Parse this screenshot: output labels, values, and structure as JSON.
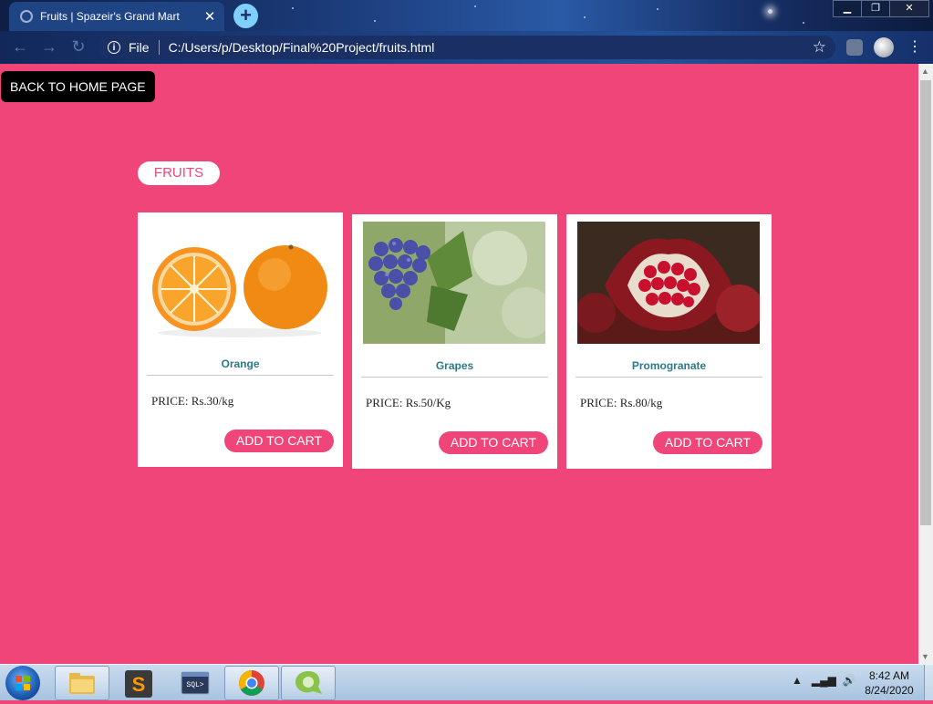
{
  "browser": {
    "tab_title": "Fruits | Spazeir's Grand Mart",
    "close_glyph": "✕",
    "new_tab_glyph": "+",
    "address": {
      "scheme": "File",
      "url": "C:/Users/p/Desktop/Final%20Project/fruits.html"
    }
  },
  "page": {
    "back_button": "BACK TO HOME PAGE",
    "section_title": "FRUITS",
    "products": [
      {
        "name": "Orange",
        "price": "PRICE: Rs.30/kg",
        "button": "ADD TO CART"
      },
      {
        "name": "Grapes",
        "price": "PRICE: Rs.50/Kg",
        "button": "ADD TO CART"
      },
      {
        "name": "Promogranate",
        "price": "PRICE: Rs.80/kg",
        "button": "ADD TO CART"
      }
    ],
    "background_color": "#ef4579"
  },
  "taskbar": {
    "apps": [
      "windows-explorer-icon",
      "sublime-text-icon",
      "sql-plus-icon",
      "chrome-icon",
      "app-icon"
    ],
    "time": "8:42 AM",
    "date": "8/24/2020"
  }
}
